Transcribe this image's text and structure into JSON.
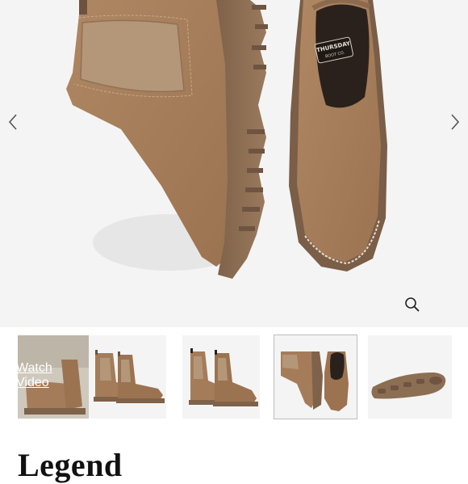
{
  "gallery": {
    "prev_icon": "chevron-left-icon",
    "next_icon": "chevron-right-icon",
    "zoom_icon": "magnifier-icon",
    "boot_brand_label": "THURSDAY",
    "boot_brand_sub": "BOOT CO.",
    "colors": {
      "suede": "#a57c5a",
      "elastic": "#b39778",
      "sole": "#8c6e53",
      "background": "#f4f4f4"
    }
  },
  "thumbnails": [
    {
      "type": "video",
      "label": "Watch\nVideo",
      "selected": false
    },
    {
      "type": "image",
      "view": "side-pair",
      "selected": false
    },
    {
      "type": "image",
      "view": "angled-pair",
      "selected": false
    },
    {
      "type": "image",
      "view": "top-down",
      "selected": true
    },
    {
      "type": "image",
      "view": "sole",
      "selected": false
    }
  ],
  "product": {
    "title": "Legend"
  }
}
